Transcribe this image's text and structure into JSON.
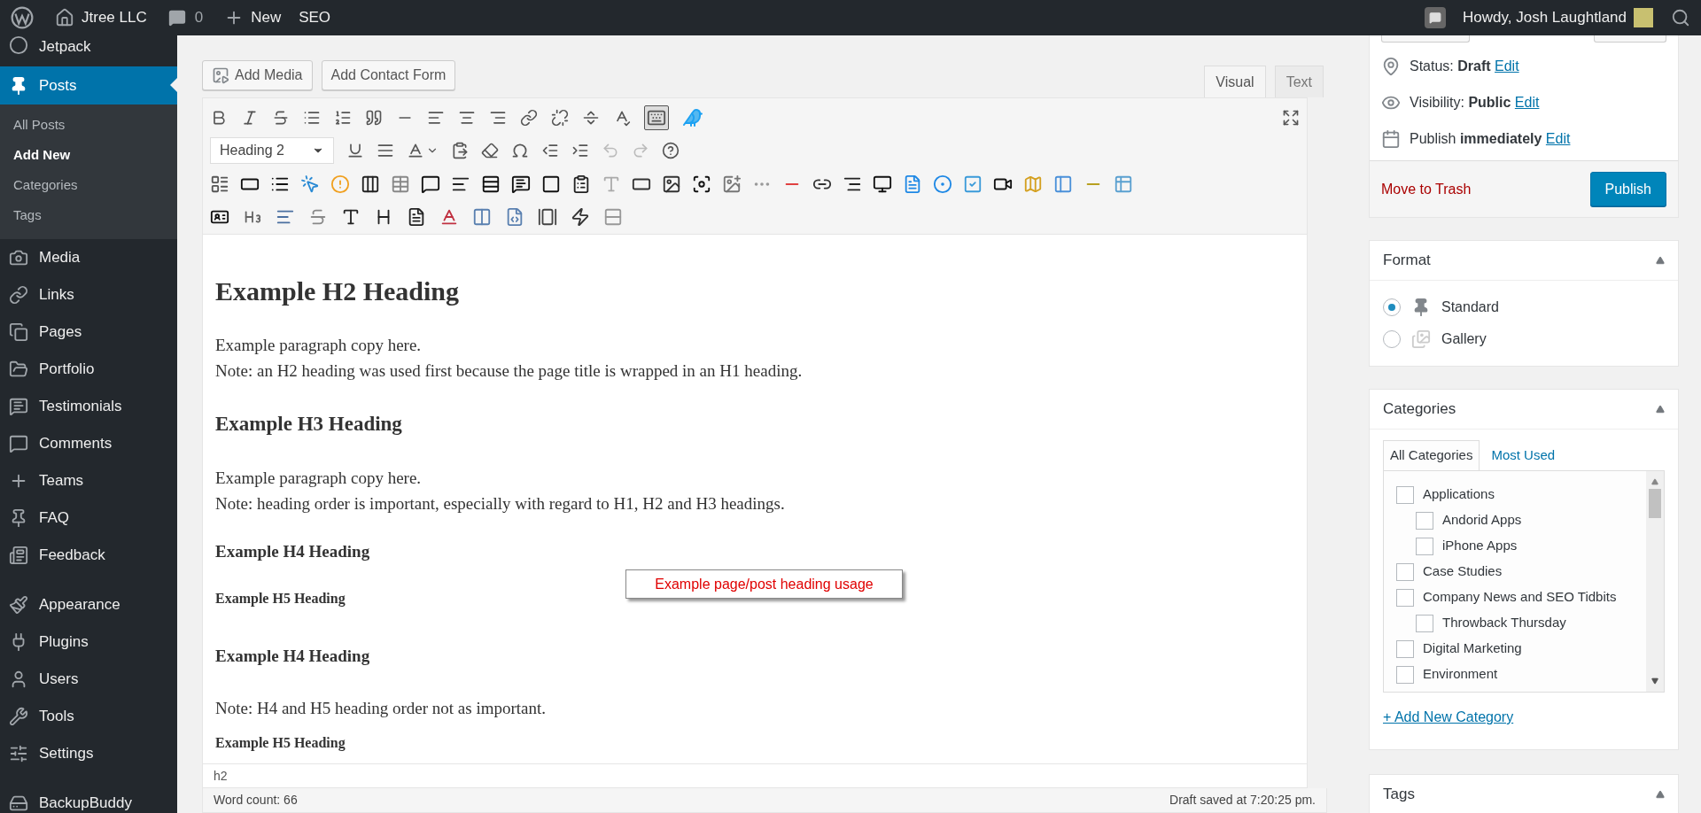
{
  "admin_bar": {
    "site": "Jtree LLC",
    "comments": "0",
    "new": "New",
    "seo": "SEO",
    "greeting": "Howdy, Josh Laughtland"
  },
  "sidebar": {
    "groups": [
      [
        {
          "label": "Jetpack",
          "selected": false
        },
        {
          "label": "Posts",
          "selected": true,
          "children": [
            {
              "label": "All Posts",
              "selected": false
            },
            {
              "label": "Add New",
              "selected": true
            },
            {
              "label": "Categories",
              "selected": false
            },
            {
              "label": "Tags",
              "selected": false
            }
          ]
        },
        {
          "label": "Media",
          "selected": false
        },
        {
          "label": "Links",
          "selected": false
        },
        {
          "label": "Pages",
          "selected": false
        },
        {
          "label": "Portfolio",
          "selected": false
        },
        {
          "label": "Testimonials",
          "selected": false
        },
        {
          "label": "Comments",
          "selected": false
        },
        {
          "label": "Teams",
          "selected": false
        },
        {
          "label": "FAQ",
          "selected": false
        },
        {
          "label": "Feedback",
          "selected": false
        }
      ],
      [
        {
          "label": "Appearance",
          "selected": false
        },
        {
          "label": "Plugins",
          "selected": false
        },
        {
          "label": "Users",
          "selected": false
        },
        {
          "label": "Tools",
          "selected": false
        },
        {
          "label": "Settings",
          "selected": false
        }
      ],
      [
        {
          "label": "BackupBuddy",
          "selected": false
        }
      ]
    ]
  },
  "editor": {
    "buttons": [
      "Add Media",
      "Add Contact Form"
    ],
    "tabs": [
      {
        "label": "Visual",
        "selected": true
      },
      {
        "label": "Text",
        "selected": false
      }
    ],
    "format_select": "Heading 2",
    "content": [
      {
        "kind": "h2",
        "text": "Example H2 Heading"
      },
      {
        "kind": "p",
        "lines": [
          "Example paragraph copy here.",
          "Note: an H2 heading was used first because the page title is wrapped in an H1 heading."
        ]
      },
      {
        "kind": "h3",
        "text": "Example H3 Heading"
      },
      {
        "kind": "p",
        "lines": [
          "Example paragraph copy here.",
          "Note: heading order is important, especially with regard to H1, H2 and H3 headings."
        ]
      },
      {
        "kind": "h4",
        "text": "Example H4 Heading"
      },
      {
        "kind": "h5",
        "text": "Example H5 Heading"
      },
      {
        "kind": "h4",
        "text": "Example H4 Heading"
      },
      {
        "kind": "p",
        "lines": [
          "Note: H4 and H5 heading order not as important."
        ]
      },
      {
        "kind": "h5",
        "text": "Example H5 Heading"
      }
    ],
    "callout": "Example page/post heading usage",
    "path": "h2",
    "word_count": "Word count: 66",
    "draft_saved": "Draft saved at 7:20:25 pm."
  },
  "publish": {
    "rows": [
      {
        "text": "Status: **Draft**",
        "link": "Edit"
      },
      {
        "text": "Visibility: **Public**",
        "link": "Edit"
      },
      {
        "text": "Publish **immediately**",
        "link": "Edit"
      }
    ],
    "trash": "Move to Trash",
    "button": "Publish"
  },
  "format": {
    "title": "Format",
    "options": [
      {
        "label": "Standard",
        "selected": true
      },
      {
        "label": "Gallery",
        "selected": false
      }
    ]
  },
  "categories": {
    "title": "Categories",
    "tabs": [
      {
        "label": "All Categories",
        "selected": true
      },
      {
        "label": "Most Used",
        "selected": false
      }
    ],
    "items": [
      {
        "label": "Applications",
        "checked": false,
        "children": [
          {
            "label": "Andorid Apps",
            "checked": false
          },
          {
            "label": "iPhone Apps",
            "checked": false
          }
        ]
      },
      {
        "label": "Case Studies",
        "checked": false
      },
      {
        "label": "Company News and SEO Tidbits",
        "checked": false,
        "children": [
          {
            "label": "Throwback Thursday",
            "checked": false
          }
        ]
      },
      {
        "label": "Digital Marketing",
        "checked": false
      },
      {
        "label": "Environment",
        "checked": false
      }
    ],
    "add_link": "+ Add New Category"
  },
  "tags": {
    "title": "Tags"
  }
}
